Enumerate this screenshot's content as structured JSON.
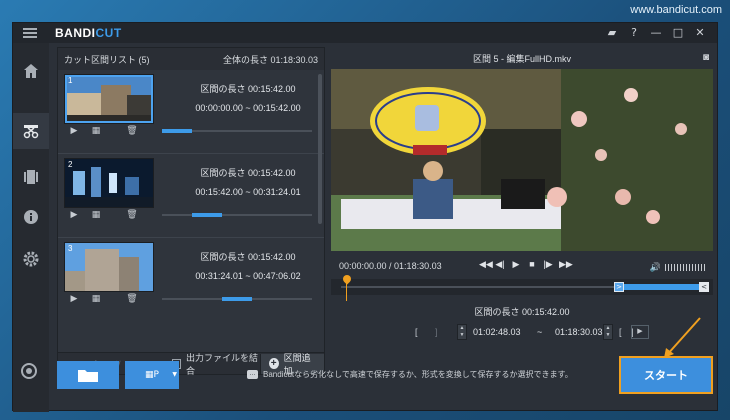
{
  "watermark": "www.bandicut.com",
  "app": {
    "logo_main": "BANDI",
    "logo_accent": "CUT"
  },
  "titlebar": {
    "icons": [
      "folder-icon",
      "help-icon",
      "minimize-icon",
      "maximize-icon",
      "close-icon"
    ],
    "glyphs": [
      "▰",
      "?",
      "—",
      "□",
      "✕"
    ]
  },
  "sidebar": {
    "items": [
      "home-icon",
      "cut-icon",
      "film-icon",
      "info-icon",
      "settings-icon"
    ]
  },
  "cut_list": {
    "title": "カット区間リスト (5)",
    "total": "全体の長さ 01:18:30.03",
    "items": [
      {
        "num": "1",
        "duration": "区間の長さ 00:15:42.00",
        "range": "00:00:00.00 ~ 00:15:42.00",
        "progress_start": 0.0,
        "progress_end": 0.2,
        "selected": true
      },
      {
        "num": "2",
        "duration": "区間の長さ 00:15:42.00",
        "range": "00:15:42.00 ~ 00:31:24.01",
        "progress_start": 0.2,
        "progress_end": 0.4,
        "selected": false
      },
      {
        "num": "3",
        "duration": "区間の長さ 00:15:42.00",
        "range": "00:31:24.01 ~ 00:47:06.02",
        "progress_start": 0.4,
        "progress_end": 0.6,
        "selected": false
      }
    ],
    "footer": {
      "merge_label": "出力ファイルを結合",
      "add_label": "区間追加"
    }
  },
  "player": {
    "title": "区間 5 - 編集FullHD.mkv",
    "time": "00:00:00.00 / 01:18:30.03",
    "section_duration": "区間の長さ 00:15:42.00",
    "range_start": "01:02:48.03",
    "range_sep": "~",
    "range_end": "01:18:30.03",
    "playhead": 0.0,
    "selection_start": 0.8,
    "selection_end": 1.0
  },
  "bottom": {
    "hint": "Bandicutなら劣化なしで高速で保存するか、形式を変換して保存するか選択できます。",
    "start_label": "スタート"
  },
  "colors": {
    "accent": "#3d9be9",
    "highlight": "#f0a020"
  }
}
